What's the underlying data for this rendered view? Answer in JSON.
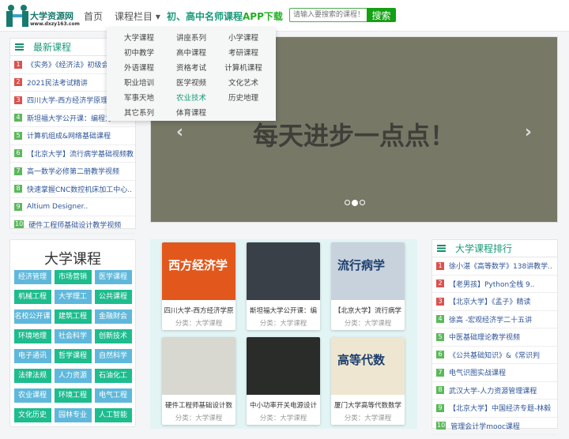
{
  "header": {
    "logo_title": "大学资源网",
    "logo_url": "www.dxzy163.com",
    "nav": [
      "首页",
      "课程栏目 ▾",
      "初、高中名师课程",
      "APP下载"
    ],
    "search_placeholder": "请输入要搜索的课程！",
    "search_button": "搜索"
  },
  "dropdown": [
    "大学课程",
    "讲座系列",
    "小学课程",
    "初中教学",
    "高中课程",
    "考研课程",
    "外语课程",
    "资格考试",
    "计算机课程",
    "职业培训",
    "医学视频",
    "文化艺术",
    "军事天地",
    "农业技术",
    "历史地理",
    "其它系列",
    "体育课程"
  ],
  "latest": {
    "title": "最新课程",
    "items": [
      "《实务》《经济法》初级会计",
      "2021民法考试精讲",
      "四川大学-西方经济学原理教",
      "斯坦福大学公开课：编程方",
      "计算机组成&网络基础课程",
      "【北京大学】流行病学基础视频教",
      "高一数学必修第二册教学视频",
      "快速掌握CNC数控机床加工中心..",
      "Altium Designer..",
      "硬件工程师基础设计教学视频"
    ]
  },
  "banner": {
    "text": "每天进步一点点！",
    "slide_count": 3,
    "active_slide": 2
  },
  "categories": {
    "title": "大学课程",
    "tags": [
      "经济管理",
      "市场营销",
      "医学课程",
      "机械工程",
      "大学理工",
      "公共课程",
      "名校公开课",
      "建筑工程",
      "金融财会",
      "环境地理",
      "社会科学",
      "创新技术",
      "电子通讯",
      "哲学课程",
      "自然科学",
      "法律法规",
      "人力资源",
      "石油化工",
      "农业课程",
      "环境工程",
      "电气工程",
      "文化历史",
      "园林专业",
      "人工智能"
    ]
  },
  "courses": [
    {
      "title": "四川大学-西方经济学原",
      "category": "分类：大学课程",
      "cover": "西方经济学",
      "color": "#e2581c"
    },
    {
      "title": "斯坦福大学公开课：编",
      "category": "分类：大学课程",
      "cover": "",
      "color": "#3a4048"
    },
    {
      "title": "【北京大学】流行病学",
      "category": "分类：大学课程",
      "cover": "流行病学",
      "color": "#c8d2dc"
    },
    {
      "title": "硬件工程师基础设计数",
      "category": "分类：大学课程",
      "cover": "",
      "color": "#d8d8d0"
    },
    {
      "title": "中小功率开关电源设计",
      "category": "分类：大学课程",
      "cover": "",
      "color": "#2a2c2a"
    },
    {
      "title": "厦门大学高等代数数学",
      "category": "分类：大学课程",
      "cover": "高等代数",
      "color": "#eee6d0"
    }
  ],
  "ranking": {
    "title": "大学课程排行",
    "items": [
      "徐小湛《高等数学》138讲教学..",
      "【老男孩】Python全栈 9..",
      "【北京大学】《孟子》精读",
      "徐高 -宏观经济学二十五讲",
      "中医基础理论教学视频",
      "《公共基础知识》&《常识判",
      "电气识图实战课程",
      "武汉大学-人力资源管理课程",
      "【北京大学】中国经济专题-林毅",
      "管理会计学mooc课程"
    ]
  }
}
